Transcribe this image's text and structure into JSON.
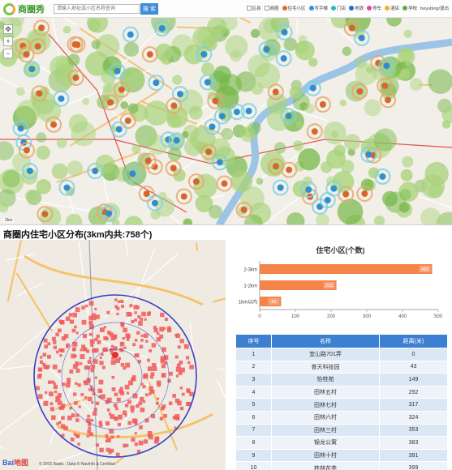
{
  "app": {
    "logo_text": "商圈秀",
    "search_placeholder": "请输入地址或小区名称查询",
    "search_button": "搜 索",
    "legend": [
      "区县",
      "商圈",
      "住宅小区",
      "写字楼",
      "门店",
      "地铁",
      "停车",
      "酒店",
      "学校"
    ],
    "user": "beyubing/退出"
  },
  "top_map": {
    "scale_text": "2km"
  },
  "section_title": "商圈内住宅小区分布(3km内共:758个)",
  "bottom_map": {
    "baidu_text_a": "Bai",
    "baidu_text_b": "地图",
    "copyright": "© 2015 Baidu - Data © NavInfo & CenNavi"
  },
  "chart_data": {
    "type": "bar",
    "orientation": "horizontal",
    "title": "住宅小区(个数)",
    "categories": [
      "2-3km",
      "1-2km",
      "1km以内"
    ],
    "values": [
      483,
      215,
      60
    ],
    "xlim": [
      0,
      500
    ],
    "xticks": [
      0,
      100,
      200,
      300,
      400,
      500
    ],
    "bar_color": "#f4844a",
    "grid": false,
    "data_labels": true
  },
  "table": {
    "headers": [
      "序号",
      "名称",
      "距离(米)"
    ],
    "rows": [
      [
        "1",
        "宜山路701弄",
        "0"
      ],
      [
        "2",
        "普天科技园",
        "43"
      ],
      [
        "3",
        "怡桂苑",
        "149"
      ],
      [
        "4",
        "田林五村",
        "292"
      ],
      [
        "5",
        "田林七村",
        "317"
      ],
      [
        "6",
        "田林六村",
        "324"
      ],
      [
        "7",
        "田林三村",
        "353"
      ],
      [
        "8",
        "锦龙公寓",
        "383"
      ],
      [
        "9",
        "田林十村",
        "391"
      ],
      [
        "10",
        "桂林花苑",
        "399"
      ]
    ]
  },
  "colors": {
    "header_blue": "#3d7fd0",
    "bar_orange": "#f4844a",
    "heat_green": "#9ccf6a",
    "circle_blue": "#3a3fc4",
    "dot_red": "#f05a5a"
  }
}
